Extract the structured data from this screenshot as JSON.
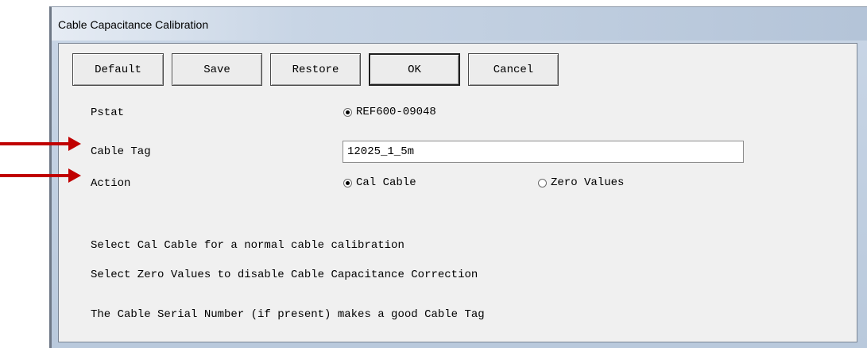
{
  "window": {
    "title": "Cable Capacitance Calibration"
  },
  "toolbar": {
    "default_label": "Default",
    "save_label": "Save",
    "restore_label": "Restore",
    "ok_label": "OK",
    "cancel_label": "Cancel"
  },
  "form": {
    "pstat_label": "Pstat",
    "pstat_option": "REF600-09048",
    "pstat_checked": true,
    "cable_tag_label": "Cable Tag",
    "cable_tag_value": "12025_1_5m",
    "action_label": "Action",
    "action_options": [
      {
        "label": "Cal Cable",
        "checked": true
      },
      {
        "label": "Zero Values",
        "checked": false
      }
    ]
  },
  "info": {
    "line1": "Select Cal Cable for a normal cable calibration",
    "line2": "Select Zero Values to disable Cable Capacitance Correction",
    "line3": "The Cable Serial Number (if present) makes a good Cable Tag"
  },
  "annotations": {
    "arrow_color": "#c00000"
  }
}
